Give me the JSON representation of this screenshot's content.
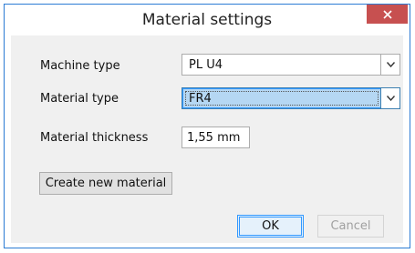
{
  "window": {
    "title": "Material settings",
    "close_glyph": "✕"
  },
  "fields": {
    "machine_type": {
      "label": "Machine type",
      "value": "PL U4"
    },
    "material_type": {
      "label": "Material type",
      "value": "FR4"
    },
    "material_thickness": {
      "label": "Material thickness",
      "value": "1,55 mm"
    }
  },
  "buttons": {
    "create_new_material": "Create new material",
    "ok": "OK",
    "cancel": "Cancel"
  },
  "colors": {
    "window_border": "#2b7bd4",
    "close_button": "#c75050",
    "focused_selection": "#b5d7f3",
    "focus_accent": "#3399ff"
  },
  "icons": {
    "close": "close-icon",
    "dropdown": "chevron-down-icon"
  }
}
